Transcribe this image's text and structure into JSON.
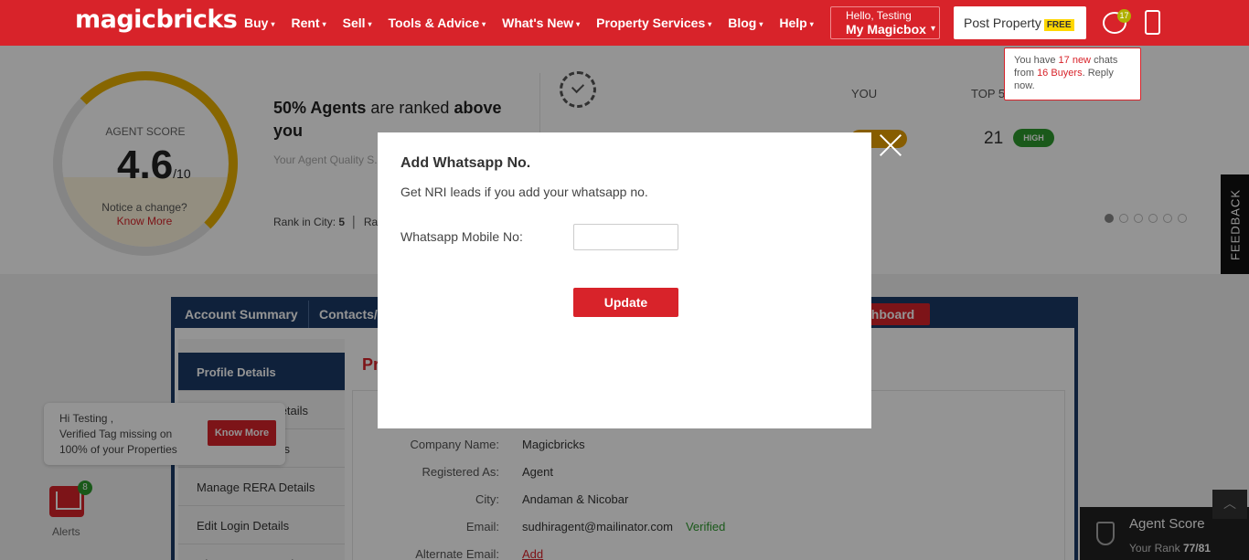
{
  "header": {
    "logo": "magicbricks",
    "nav": [
      "Buy",
      "Rent",
      "Sell",
      "Tools & Advice",
      "What's New",
      "Property Services",
      "Blog",
      "Help"
    ],
    "hello_line1": "Hello, Testing",
    "hello_line2": "My Magicbox",
    "post_property": "Post Property",
    "free_tag": "FREE",
    "chat_badge": "17",
    "chat_tooltip": {
      "p1": "You have ",
      "count": "17 new",
      "p2": " chats from ",
      "buyers": "16 Buyers",
      "p3": ". Reply now."
    }
  },
  "agent_panel": {
    "score_label": "AGENT SCORE",
    "score_value": "4.6",
    "score_out_of": "/10",
    "notice": "Notice a change?",
    "know_more": "Know More",
    "headline_pct": "50% Agents",
    "headline_mid": " are ranked ",
    "headline_bold": "above",
    "headline_end": "you",
    "sub_text": "Your Agent Quality S... your listing in search...",
    "rank_city_label": "Rank in City: ",
    "rank_city_value": "5",
    "rank_extra": "Ra",
    "col_you": "YOU",
    "col_top": "TOP 5",
    "top_value": "21",
    "high_label": "HIGH"
  },
  "feedback": "FEEDBACK",
  "dashboard": {
    "tabs": [
      "Account Summary",
      "Contacts/I",
      "shboard"
    ],
    "side_menu": [
      "Profile Details",
      "...etails",
      "...s",
      "Manage RERA Details",
      "Edit Login Details",
      "Change Password"
    ],
    "content_title": "Pr",
    "details": [
      {
        "label": "Company Name:",
        "value": "Magicbricks"
      },
      {
        "label": "Registered As:",
        "value": "Agent"
      },
      {
        "label": "City:",
        "value": "Andaman & Nicobar"
      },
      {
        "label": "Email:",
        "value": "sudhiragent@mailinator.com",
        "badge": "Verified"
      },
      {
        "label": "Alternate Email:",
        "value": "Add"
      }
    ]
  },
  "hi_popup": {
    "line1": "Hi Testing ,",
    "line2": "Verified Tag missing on",
    "line3": "100% of your Properties",
    "button": "Know More"
  },
  "alerts": {
    "label": "Alerts",
    "badge": "8"
  },
  "score_widget": {
    "title": "Agent Score",
    "rank_label": "Your Rank ",
    "rank_value": "77/81"
  },
  "modal": {
    "title": "Add Whatsapp No.",
    "subtitle": "Get NRI leads if you add your whatsapp no.",
    "field_label": "Whatsapp Mobile No:",
    "field_value": "",
    "button": "Update"
  }
}
